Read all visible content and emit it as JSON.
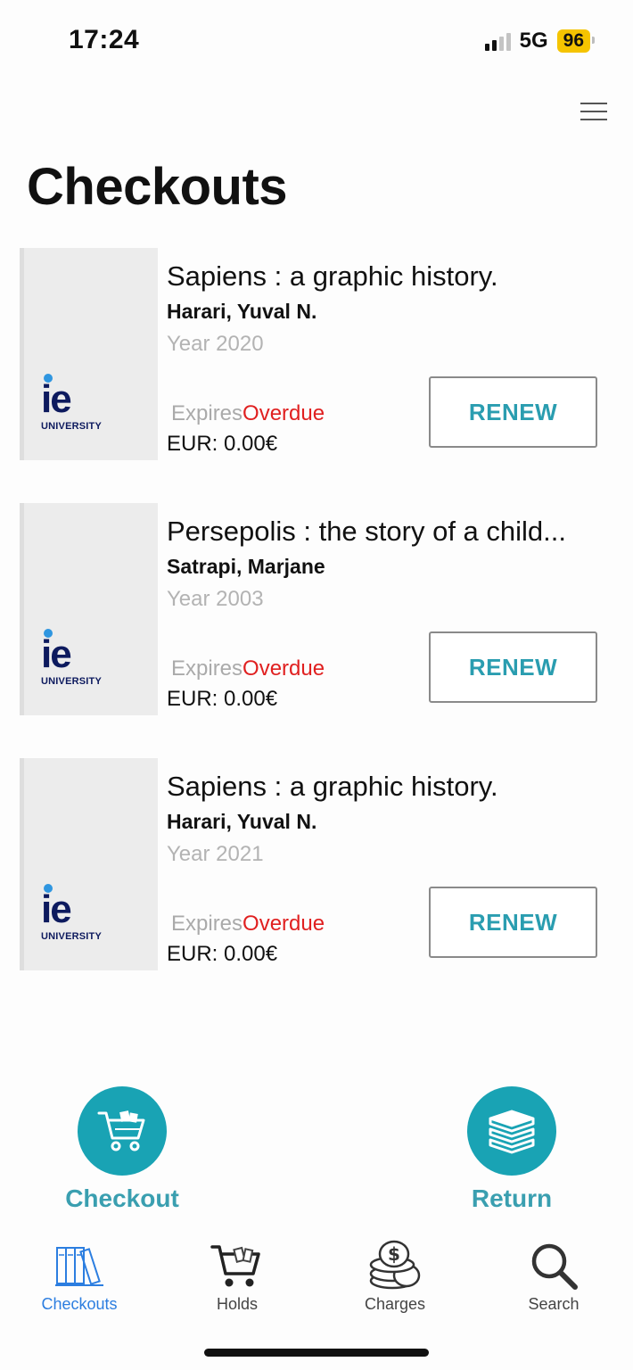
{
  "status_bar": {
    "time": "17:24",
    "network": "5G",
    "battery": "96"
  },
  "page": {
    "title": "Checkouts"
  },
  "checkouts": [
    {
      "title": "Sapiens : a graphic history.",
      "author": "Harari, Yuval N.",
      "year": "Year 2020",
      "expires_label": "Expires",
      "expiry_status": "Overdue",
      "charge": "EUR: 0.00€",
      "renew_label": "RENEW",
      "cover_logo": "ie",
      "cover_logo_sub": "UNIVERSITY"
    },
    {
      "title": "Persepolis : the story of a child...",
      "author": "Satrapi, Marjane",
      "year": "Year 2003",
      "expires_label": "Expires",
      "expiry_status": "Overdue",
      "charge": "EUR: 0.00€",
      "renew_label": "RENEW",
      "cover_logo": "ie",
      "cover_logo_sub": "UNIVERSITY"
    },
    {
      "title": "Sapiens : a graphic history.",
      "author": "Harari, Yuval N.",
      "year": "Year 2021",
      "expires_label": "Expires",
      "expiry_status": "Overdue",
      "charge": "EUR: 0.00€",
      "renew_label": "RENEW",
      "cover_logo": "ie",
      "cover_logo_sub": "UNIVERSITY"
    }
  ],
  "actions": {
    "checkout_label": "Checkout",
    "return_label": "Return"
  },
  "tabs": [
    {
      "label": "Checkouts",
      "icon": "bookshelf-icon",
      "active": true
    },
    {
      "label": "Holds",
      "icon": "cart-icon",
      "active": false
    },
    {
      "label": "Charges",
      "icon": "coins-icon",
      "active": false
    },
    {
      "label": "Search",
      "icon": "search-icon",
      "active": false
    }
  ],
  "colors": {
    "accent": "#19a3b4",
    "overdue": "#e02020",
    "active_tab": "#2c7ee0",
    "battery": "#f5c400"
  }
}
